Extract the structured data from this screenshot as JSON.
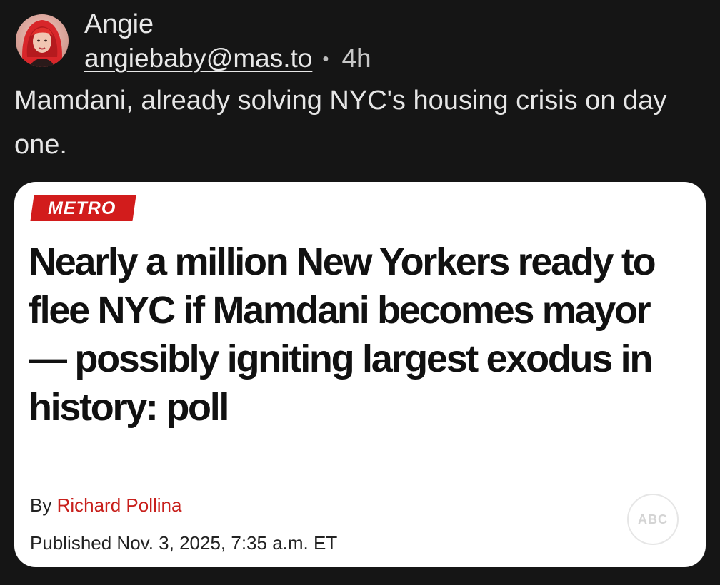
{
  "post": {
    "author": {
      "display_name": "Angie",
      "handle": "angiebaby@mas.to",
      "avatar_icon": "profile-photo-red-hair"
    },
    "separator": "•",
    "timestamp": "4h",
    "text": "Mamdani, already solving NYC's housing crisis on day one."
  },
  "card": {
    "section": "METRO",
    "headline": "Nearly a million New Yorkers ready to flee NYC if Mamdani becomes mayor — possibly igniting largest exodus in history: poll",
    "byline_prefix": "By",
    "author": "Richard Pollina",
    "published": "Published Nov. 3, 2025, 7:35 a.m. ET",
    "badge": "ABC",
    "colors": {
      "section_tag": "#d21c1c",
      "author_link": "#c8201c",
      "background": "#151515",
      "card": "#ffffff"
    }
  }
}
